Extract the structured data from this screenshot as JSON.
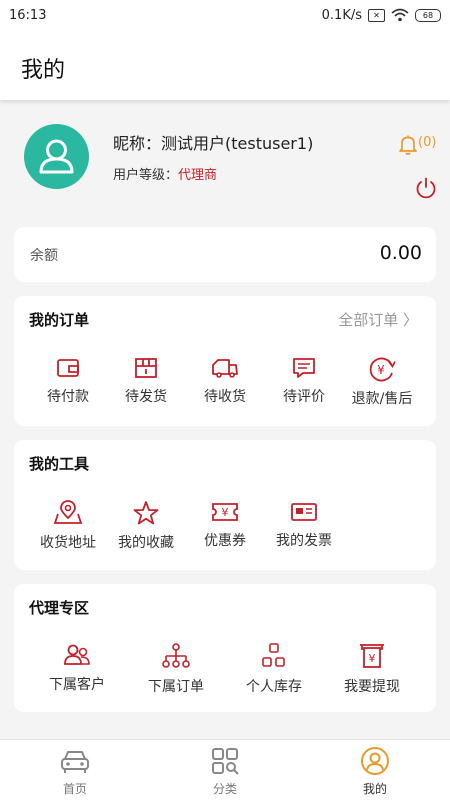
{
  "status": {
    "time": "16:13",
    "speed": "0.1K/s",
    "battery": "68"
  },
  "header": {
    "title": "我的"
  },
  "profile": {
    "nickname_label": "昵称：",
    "nickname": "测试用户(testuser1)",
    "level_label": "用户等级：",
    "level": "代理商",
    "notification_count": "(0)"
  },
  "balance": {
    "label": "余额",
    "value": "0.00"
  },
  "orders": {
    "title": "我的订单",
    "all_link": "全部订单 〉",
    "items": [
      {
        "label": "待付款",
        "icon": "wallet-icon"
      },
      {
        "label": "待发货",
        "icon": "package-icon"
      },
      {
        "label": "待收货",
        "icon": "truck-icon"
      },
      {
        "label": "待评价",
        "icon": "comment-icon"
      },
      {
        "label": "退款/售后",
        "icon": "refund-icon"
      }
    ]
  },
  "tools": {
    "title": "我的工具",
    "items": [
      {
        "label": "收货地址",
        "icon": "location-icon"
      },
      {
        "label": "我的收藏",
        "icon": "star-icon"
      },
      {
        "label": "优惠券",
        "icon": "coupon-icon"
      },
      {
        "label": "我的发票",
        "icon": "invoice-icon"
      }
    ]
  },
  "agent": {
    "title": "代理专区",
    "items": [
      {
        "label": "下属客户",
        "icon": "customers-icon"
      },
      {
        "label": "下属订单",
        "icon": "hierarchy-icon"
      },
      {
        "label": "个人库存",
        "icon": "inventory-icon"
      },
      {
        "label": "我要提现",
        "icon": "withdraw-icon"
      }
    ]
  },
  "tabbar": {
    "items": [
      {
        "label": "首页",
        "icon": "car-icon"
      },
      {
        "label": "分类",
        "icon": "category-icon"
      },
      {
        "label": "我的",
        "icon": "user-icon"
      }
    ],
    "active_color": "#e89a2b"
  },
  "colors": {
    "accent": "#c4202a",
    "avatar_bg": "#2bb8a0",
    "bell": "#e89a2b"
  }
}
